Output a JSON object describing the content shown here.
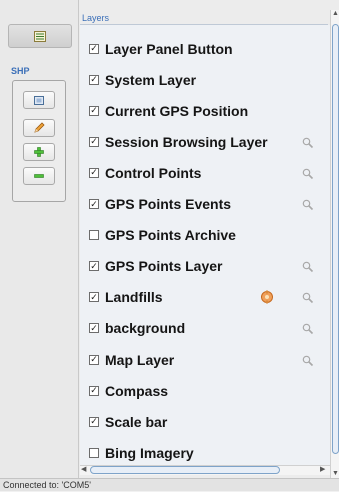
{
  "panel": {
    "title": "Layers"
  },
  "toolbar": {
    "layer_panel_icon": "list-icon",
    "shp_label": "SHP",
    "buttons": [
      {
        "name": "select-icon"
      },
      {
        "name": "pencil-icon"
      },
      {
        "name": "plus-icon"
      },
      {
        "name": "minus-icon"
      }
    ]
  },
  "layers": [
    {
      "label": "Layer Panel Button",
      "checked": true,
      "zoom": false
    },
    {
      "label": "System Layer",
      "checked": true,
      "zoom": false
    },
    {
      "label": "Current GPS Position",
      "checked": true,
      "zoom": false
    },
    {
      "label": "Session Browsing Layer",
      "checked": true,
      "zoom": true
    },
    {
      "label": "Control Points",
      "checked": true,
      "zoom": true
    },
    {
      "label": "GPS Points Events",
      "checked": true,
      "zoom": true
    },
    {
      "label": "GPS Points Archive",
      "checked": false,
      "zoom": false
    },
    {
      "label": "GPS Points Layer",
      "checked": true,
      "zoom": true
    },
    {
      "label": "Landfills",
      "checked": true,
      "zoom": true,
      "extra_icon": "layer-settings-icon"
    },
    {
      "label": "background",
      "checked": true,
      "zoom": true
    },
    {
      "label": "Map Layer",
      "checked": true,
      "zoom": true
    },
    {
      "label": "Compass",
      "checked": true,
      "zoom": false
    },
    {
      "label": "Scale bar",
      "checked": true,
      "zoom": false
    },
    {
      "label": "Bing Imagery",
      "checked": false,
      "zoom": false
    }
  ],
  "status": {
    "text": "Connected to: 'COM5'"
  },
  "colors": {
    "accent": "#3b6fb8",
    "list_background": "#eef1f5"
  }
}
